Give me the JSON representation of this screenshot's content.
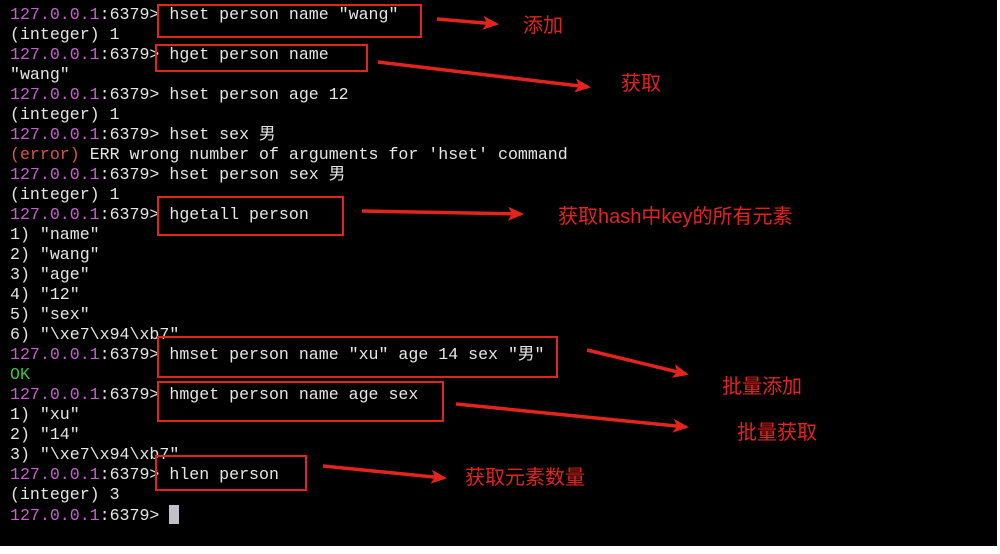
{
  "terminal": {
    "prompt_host": "127.0.0.1",
    "prompt_port": ":6379>",
    "lines": [
      {
        "type": "prompt",
        "command": "hset person name \"wang\""
      },
      {
        "type": "output",
        "text": "(integer) 1"
      },
      {
        "type": "prompt",
        "command": "hget person name"
      },
      {
        "type": "output",
        "text": "\"wang\""
      },
      {
        "type": "prompt",
        "command": "hset person age 12"
      },
      {
        "type": "output",
        "text": "(integer) 1"
      },
      {
        "type": "prompt",
        "command": "hset sex 男"
      },
      {
        "type": "error",
        "tag": "(error)",
        "text": "ERR wrong number of arguments for 'hset' command"
      },
      {
        "type": "prompt",
        "command": "hset person sex 男"
      },
      {
        "type": "output",
        "text": "(integer) 1"
      },
      {
        "type": "prompt",
        "command": "hgetall person"
      },
      {
        "type": "output",
        "text": "1) \"name\""
      },
      {
        "type": "output",
        "text": "2) \"wang\""
      },
      {
        "type": "output",
        "text": "3) \"age\""
      },
      {
        "type": "output",
        "text": "4) \"12\""
      },
      {
        "type": "output",
        "text": "5) \"sex\""
      },
      {
        "type": "output",
        "text": "6) \"\\xe7\\x94\\xb7\""
      },
      {
        "type": "prompt",
        "command": "hmset person name \"xu\" age 14 sex \"男\""
      },
      {
        "type": "ok",
        "text": "OK"
      },
      {
        "type": "prompt",
        "command": "hmget person name age sex"
      },
      {
        "type": "output",
        "text": "1) \"xu\""
      },
      {
        "type": "output",
        "text": "2) \"14\""
      },
      {
        "type": "output",
        "text": "3) \"\\xe7\\x94\\xb7\""
      },
      {
        "type": "prompt",
        "command": "hlen person"
      },
      {
        "type": "output",
        "text": "(integer) 3"
      },
      {
        "type": "prompt",
        "command": "",
        "cursor": true
      }
    ]
  },
  "annotations": [
    {
      "label": "添加"
    },
    {
      "label": "获取"
    },
    {
      "label": "获取hash中key的所有元素"
    },
    {
      "label": "批量添加"
    },
    {
      "label": "批量获取"
    },
    {
      "label": "获取元素数量"
    }
  ],
  "colors": {
    "terminal_background": "#000000",
    "terminal_text": "#e6e6e6",
    "prompt_host": "#c75fd0",
    "error": "#d9534f",
    "ok": "#3fc43f",
    "annotation": "#e3241c"
  }
}
